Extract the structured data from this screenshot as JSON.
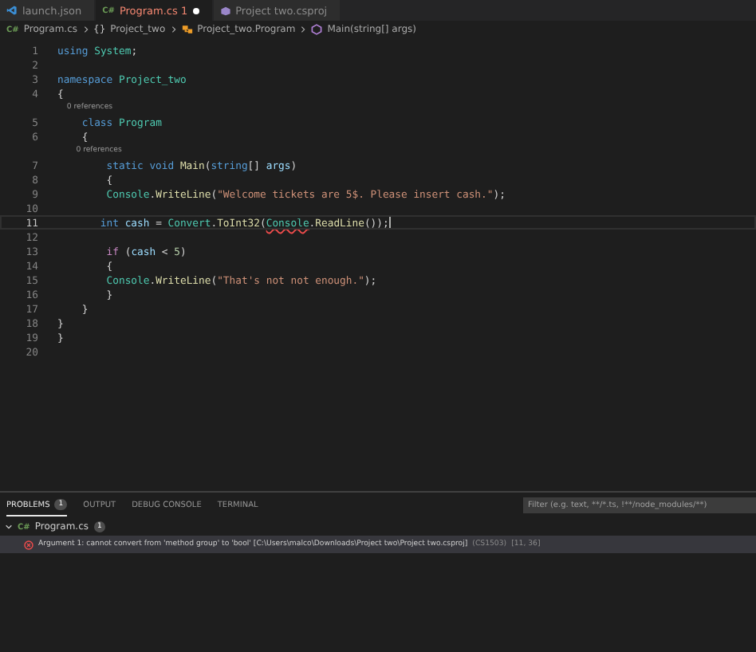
{
  "tabs": [
    {
      "label": "launch.json",
      "kind": "json",
      "selected": false,
      "error": false,
      "modified": false
    },
    {
      "label": "Program.cs",
      "kind": "csharp",
      "glyph": "C#",
      "selected": true,
      "error": true,
      "badge": "1",
      "modified": true
    },
    {
      "label": "Project two.csproj",
      "kind": "project",
      "selected": false,
      "error": false,
      "modified": false
    }
  ],
  "breadcrumbs": [
    {
      "label": "Program.cs",
      "kind": "csharp",
      "glyph": "C#"
    },
    {
      "label": "Project_two",
      "kind": "namespace",
      "glyph": "{}"
    },
    {
      "label": "Project_two.Program",
      "kind": "class"
    },
    {
      "label": "Main(string[] args)",
      "kind": "method"
    }
  ],
  "code": [
    {
      "kind": "code",
      "number": "1",
      "current": false,
      "tokens": [
        {
          "kind": "keyword",
          "s": "using "
        },
        {
          "kind": "type",
          "s": "System"
        },
        {
          "kind": "plain",
          "s": ";"
        }
      ]
    },
    {
      "kind": "code",
      "number": "2",
      "current": false
    },
    {
      "kind": "code",
      "number": "3",
      "current": false,
      "tokens": [
        {
          "kind": "keyword",
          "s": "namespace "
        },
        {
          "kind": "type",
          "s": "Project_two"
        }
      ]
    },
    {
      "kind": "code",
      "number": "4",
      "current": false,
      "tokens": [
        {
          "kind": "plain",
          "s": "{"
        }
      ]
    },
    {
      "kind": "codelens",
      "text": "0 references"
    },
    {
      "kind": "code",
      "number": "5",
      "current": false,
      "tokens": [
        {
          "kind": "keyword",
          "s": "    class "
        },
        {
          "kind": "type",
          "s": "Program"
        }
      ]
    },
    {
      "kind": "code",
      "number": "6",
      "current": false,
      "tokens": [
        {
          "kind": "plain",
          "s": "    {"
        }
      ]
    },
    {
      "kind": "codelens",
      "text": "0 references"
    },
    {
      "kind": "code",
      "number": "7",
      "current": false,
      "tokens": [
        {
          "kind": "keyword",
          "s": "        static void "
        },
        {
          "kind": "function",
          "s": "Main"
        },
        {
          "kind": "plain",
          "s": "("
        },
        {
          "kind": "keyword",
          "s": "string"
        },
        {
          "kind": "plain",
          "s": "[] "
        },
        {
          "kind": "variable",
          "s": "args"
        },
        {
          "kind": "plain",
          "s": ")"
        }
      ]
    },
    {
      "kind": "code",
      "number": "8",
      "current": false,
      "tokens": [
        {
          "kind": "plain",
          "s": "        {"
        }
      ]
    },
    {
      "kind": "code",
      "number": "9",
      "current": false,
      "tokens": [
        {
          "kind": "type",
          "s": "        Console"
        },
        {
          "kind": "plain",
          "s": "."
        },
        {
          "kind": "function",
          "s": "WriteLine"
        },
        {
          "kind": "plain",
          "s": "("
        },
        {
          "kind": "string",
          "s": "\"Welcome tickets are 5$. Please insert cash.\""
        },
        {
          "kind": "plain",
          "s": ");"
        }
      ]
    },
    {
      "kind": "code",
      "number": "10",
      "current": false
    },
    {
      "kind": "code",
      "number": "11",
      "current": true,
      "tokens": [
        {
          "kind": "keyword",
          "s": "       int "
        },
        {
          "kind": "variable",
          "s": "cash"
        },
        {
          "kind": "plain",
          "s": " = "
        },
        {
          "kind": "type",
          "s": "Convert"
        },
        {
          "kind": "plain",
          "s": "."
        },
        {
          "kind": "function",
          "s": "ToInt32"
        },
        {
          "kind": "plain",
          "s": "("
        },
        {
          "kind": "type",
          "s": "Console",
          "error": true
        },
        {
          "kind": "plain",
          "s": "."
        },
        {
          "kind": "function",
          "s": "ReadLine"
        },
        {
          "kind": "plain",
          "s": "());"
        }
      ]
    },
    {
      "kind": "code",
      "number": "12",
      "current": false
    },
    {
      "kind": "code",
      "number": "13",
      "current": false,
      "tokens": [
        {
          "kind": "control",
          "s": "        if"
        },
        {
          "kind": "plain",
          "s": " ("
        },
        {
          "kind": "variable",
          "s": "cash"
        },
        {
          "kind": "plain",
          "s": " < "
        },
        {
          "kind": "number",
          "s": "5"
        },
        {
          "kind": "plain",
          "s": ")"
        }
      ]
    },
    {
      "kind": "code",
      "number": "14",
      "current": false,
      "tokens": [
        {
          "kind": "plain",
          "s": "        {"
        }
      ]
    },
    {
      "kind": "code",
      "number": "15",
      "current": false,
      "tokens": [
        {
          "kind": "type",
          "s": "        Console"
        },
        {
          "kind": "plain",
          "s": "."
        },
        {
          "kind": "function",
          "s": "WriteLine"
        },
        {
          "kind": "plain",
          "s": "("
        },
        {
          "kind": "string",
          "s": "\"That's not not enough.\""
        },
        {
          "kind": "plain",
          "s": ");"
        }
      ]
    },
    {
      "kind": "code",
      "number": "16",
      "current": false,
      "tokens": [
        {
          "kind": "plain",
          "s": "        }"
        }
      ]
    },
    {
      "kind": "code",
      "number": "17",
      "current": false,
      "tokens": [
        {
          "kind": "plain",
          "s": "    }"
        }
      ]
    },
    {
      "kind": "code",
      "number": "18",
      "current": false,
      "tokens": [
        {
          "kind": "plain",
          "s": "}"
        }
      ]
    },
    {
      "kind": "code",
      "number": "19",
      "current": false,
      "tokens": [
        {
          "kind": "plain",
          "s": "}"
        }
      ]
    },
    {
      "kind": "code",
      "number": "20",
      "current": false
    }
  ],
  "panel": {
    "tabs": [
      {
        "label": "PROBLEMS",
        "badge": "1",
        "selected": true
      },
      {
        "label": "OUTPUT",
        "selected": false
      },
      {
        "label": "DEBUG CONSOLE",
        "selected": false
      },
      {
        "label": "TERMINAL",
        "selected": false
      }
    ],
    "filter": {
      "placeholder": "Filter (e.g. text, **/*.ts, !**/node_modules/**)"
    },
    "file": {
      "label": "Program.cs",
      "glyph": "C#",
      "badge": "1",
      "expanded": true
    },
    "problems": [
      {
        "message": "Argument 1: cannot convert from 'method group' to 'bool' [C:\\Users\\malco\\Downloads\\Project two\\Project two.csproj]",
        "code": "(CS1503)",
        "position": "[11, 36]"
      }
    ]
  }
}
